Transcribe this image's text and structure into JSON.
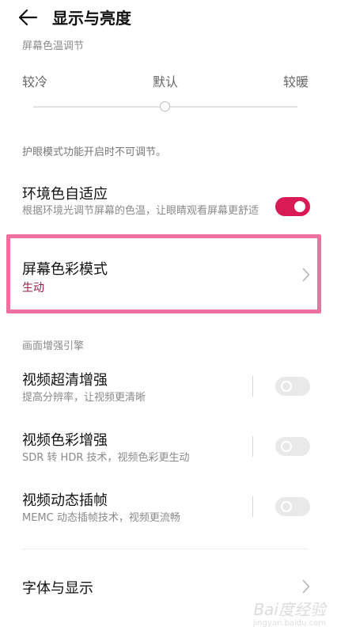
{
  "header": {
    "title": "显示与亮度",
    "back_icon": "arrow-left-icon"
  },
  "color_temp": {
    "section_label": "屏幕色温调节",
    "cold": "较冷",
    "default": "默认",
    "warm": "较暖",
    "level": 0.5,
    "note": "护眼模式功能开启时不可调节。"
  },
  "ambient": {
    "title": "环境色自适应",
    "subtitle": "根据环境光调节屏幕的色温，让眼睛观看屏幕更舒适",
    "enabled": true
  },
  "color_mode": {
    "title": "屏幕色彩模式",
    "value": "生动"
  },
  "engine": {
    "section_label": "画面增强引擎",
    "items": [
      {
        "title": "视频超清增强",
        "subtitle": "提高分辨率，让视频更清晰",
        "enabled": false
      },
      {
        "title": "视频色彩增强",
        "subtitle": "SDR 转 HDR 技术，视频色彩更生动",
        "enabled": false
      },
      {
        "title": "视频动态插帧",
        "subtitle": "MEMC 动态插帧技术，视频更流畅",
        "enabled": false
      }
    ]
  },
  "font_display": {
    "title": "字体与显示"
  },
  "watermark": {
    "text": "Bai度经验",
    "sub": "jingyan.baidu.com"
  },
  "colors": {
    "accent": "#d81b55",
    "value_text": "#9b1b4a",
    "highlight": "#ef6f9e"
  }
}
